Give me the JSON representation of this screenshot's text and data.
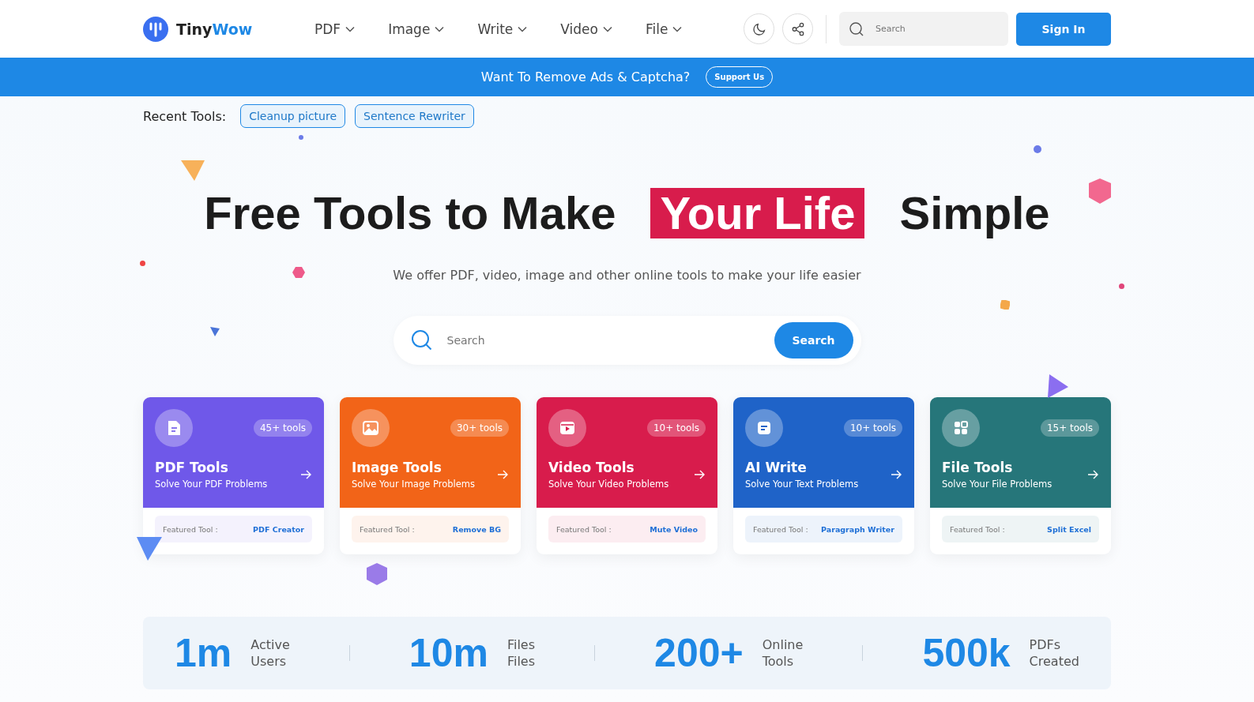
{
  "header": {
    "logo": {
      "part_1": "Tiny",
      "part_2": "Wow"
    },
    "nav": [
      {
        "label": "PDF"
      },
      {
        "label": "Image"
      },
      {
        "label": "Write"
      },
      {
        "label": "Video"
      },
      {
        "label": "File"
      }
    ],
    "search": {
      "placeholder": "Search"
    },
    "sign_in": "Sign In"
  },
  "banner": {
    "text": "Want To Remove Ads & Captcha?",
    "button": "Support Us"
  },
  "recent_tools": {
    "label": "Recent Tools:",
    "items": [
      "Cleanup picture",
      "Sentence Rewriter"
    ]
  },
  "hero": {
    "title_before": "Free Tools to Make",
    "title_highlight": "Your Life",
    "title_after": "Simple",
    "subtitle": "We offer PDF, video, image and other online tools to make your life easier",
    "search": {
      "placeholder": "Search",
      "button": "Search"
    }
  },
  "cards": [
    {
      "title": "PDF Tools",
      "subtitle": "Solve Your PDF Problems",
      "count": "45+ tools",
      "color": "#6f58e9",
      "featured_label": "Featured Tool :",
      "featured_tool": "PDF Creator"
    },
    {
      "title": "Image Tools",
      "subtitle": "Solve Your Image Problems",
      "count": "30+ tools",
      "color": "#f26418",
      "featured_label": "Featured Tool :",
      "featured_tool": "Remove BG"
    },
    {
      "title": "Video Tools",
      "subtitle": "Solve Your Video Problems",
      "count": "10+ tools",
      "color": "#d81c4c",
      "featured_label": "Featured Tool :",
      "featured_tool": "Mute Video"
    },
    {
      "title": "AI Write",
      "subtitle": "Solve Your Text Problems",
      "count": "10+ tools",
      "color": "#1f63c8",
      "featured_label": "Featured Tool :",
      "featured_tool": "Paragraph Writer"
    },
    {
      "title": "File Tools",
      "subtitle": "Solve Your File Problems",
      "count": "15+ tools",
      "color": "#26767a",
      "featured_label": "Featured Tool :",
      "featured_tool": "Split Excel"
    }
  ],
  "stats": [
    {
      "value": "1m",
      "line_1": "Active",
      "line_2": "Users"
    },
    {
      "value": "10m",
      "line_1": "Files",
      "line_2": "Files"
    },
    {
      "value": "200+",
      "line_1": "Online",
      "line_2": "Tools"
    },
    {
      "value": "500k",
      "line_1": "PDFs",
      "line_2": "Created"
    }
  ]
}
